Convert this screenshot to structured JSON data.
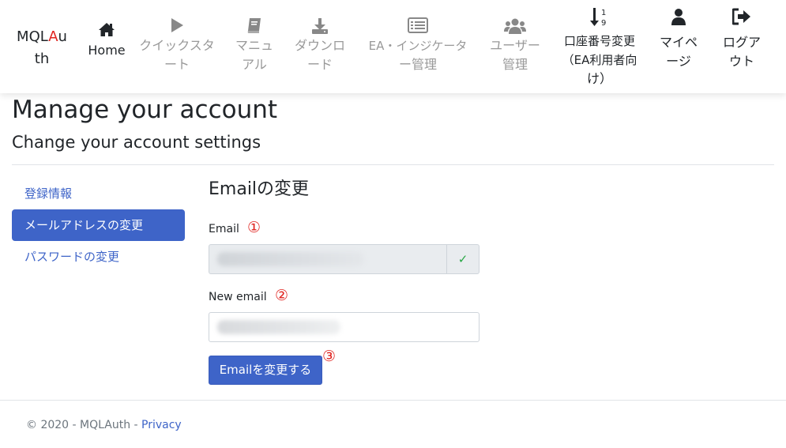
{
  "navbar": {
    "brand_pre": "MQL",
    "brand_red": "A",
    "brand_post": "u",
    "brand_line2": "th",
    "items": [
      {
        "label": "Home",
        "icon": "home-icon"
      },
      {
        "label": "クイックスタート",
        "line1": "クイックスタ",
        "line2": "ート",
        "icon": "play-icon"
      },
      {
        "label": "マニュアル",
        "line1": "マニュ",
        "line2": "アル",
        "icon": "book-icon"
      },
      {
        "label": "ダウンロード",
        "line1": "ダウンロ",
        "line2": "ード",
        "icon": "download-icon"
      },
      {
        "label": "EA・インジケーター管理",
        "line1": "EA・インジケータ",
        "line2": "ー管理",
        "icon": "list-icon"
      },
      {
        "label": "ユーザー管理",
        "line1": "ユーザー",
        "line2": "管理",
        "icon": "users-icon"
      },
      {
        "label": "口座番号変更（EA利用者向け）",
        "line1": "口座番号変更",
        "line2": "（EA利用者向",
        "line3": "け）",
        "icon": "sort-numeric-icon"
      },
      {
        "label": "マイページ",
        "line1": "マイペ",
        "line2": "ージ",
        "icon": "user-icon"
      },
      {
        "label": "ログアウト",
        "line1": "ログア",
        "line2": "ウト",
        "icon": "sign-out-icon"
      }
    ]
  },
  "page": {
    "title": "Manage your account",
    "subtitle": "Change your account settings"
  },
  "sidenav": {
    "items": [
      {
        "label": "登録情報",
        "active": false
      },
      {
        "label": "メールアドレスの変更",
        "active": true
      },
      {
        "label": "パスワードの変更",
        "active": false
      }
    ]
  },
  "form": {
    "title": "Emailの変更",
    "email_label": "Email",
    "email_marker": "①",
    "email_value": "",
    "new_email_label": "New email",
    "new_email_marker": "②",
    "new_email_value": "",
    "submit_label": "Emailを変更する",
    "submit_marker": "③",
    "check_icon": "✓"
  },
  "footer": {
    "copyright": "© 2020 - MQLAuth - ",
    "privacy": "Privacy"
  },
  "colors": {
    "primary": "#3e64c8",
    "marker": "#e0231f",
    "success": "#28a745"
  }
}
